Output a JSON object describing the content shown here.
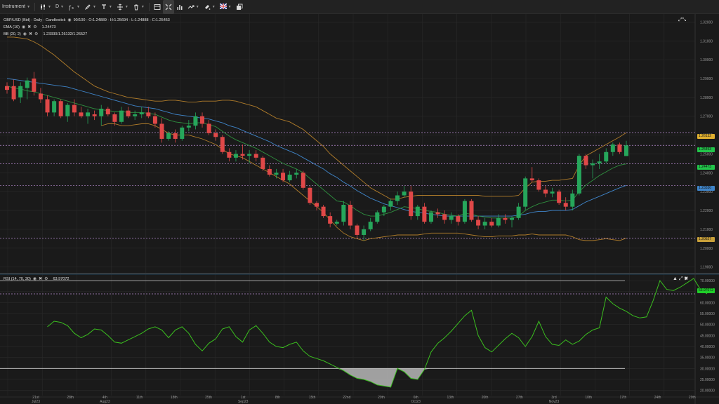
{
  "toolbar": {
    "instrument_label": "Instrument",
    "timeframe_label": "D",
    "flag_icon": "uk-flag-icon",
    "items": [
      {
        "name": "instrument-dropdown",
        "icon": "",
        "label": "Instrument"
      },
      {
        "name": "chart-type-dropdown",
        "icon": "candlestick-icon"
      },
      {
        "name": "timeframe-dropdown",
        "label": "D"
      },
      {
        "name": "indicators-dropdown",
        "icon": "indicator-icon"
      },
      {
        "name": "drawing-tools-dropdown",
        "icon": "pencil-icon"
      },
      {
        "name": "text-tools-dropdown",
        "icon": "text-icon"
      },
      {
        "name": "zoom-dropdown",
        "icon": "zoom-icon"
      },
      {
        "name": "delete-dropdown",
        "icon": "trash-icon"
      },
      {
        "name": "layout-button",
        "icon": "layout-icon"
      },
      {
        "name": "crosshair-button",
        "icon": "crosshair-icon"
      },
      {
        "name": "volume-button",
        "icon": "bars-icon"
      },
      {
        "name": "trade-dropdown",
        "icon": "arrow-icon"
      },
      {
        "name": "settings-dropdown",
        "icon": "paint-icon"
      },
      {
        "name": "language-dropdown",
        "icon": "uk-flag-icon"
      },
      {
        "name": "popout-button",
        "icon": "window-icon"
      }
    ]
  },
  "legend": {
    "main": "GBP/USD (Bid) - Daily - Candlestick",
    "ohlc": "90/100 - O:1.24889 - H:1.25694 - L:1.24888 - C:1.25453",
    "ema_name": "EMA (10)",
    "ema_value": "1.24473",
    "bb_name": "BB (20, 2)",
    "bb_value": "1.23330/1.26132/1.26527",
    "rsi_name": "RSI (14, 70, 30)",
    "rsi_value": "63.97072"
  },
  "colors": {
    "background": "#1a1a1a",
    "up": "#26a65b",
    "down": "#e04848",
    "ema": "#2f8f3f",
    "bb_outer": "#b07c2a",
    "bb_mid": "#3f84c8",
    "rsi_line": "#3bbf1f",
    "grid": "#2a2a2a",
    "hline": "#b68ad0"
  },
  "price_axis": {
    "ticks": [
      "1.32000",
      "1.31000",
      "1.30000",
      "1.29000",
      "1.28000",
      "1.27000",
      "1.26000",
      "1.25000",
      "1.24000",
      "1.23000",
      "1.22000",
      "1.21000",
      "1.20000",
      "1.19000"
    ],
    "markers": [
      {
        "label": "1.26132",
        "color": "#e0b030"
      },
      {
        "label": "1.25453",
        "color": "#22c44a"
      },
      {
        "label": "1.24473",
        "color": "#22c44a"
      },
      {
        "label": "1.23330",
        "color": "#3f84c8"
      },
      {
        "label": "1.20527",
        "color": "#c8a03a"
      }
    ]
  },
  "rsi_axis": {
    "ticks": [
      "70.00000",
      "65.00000",
      "60.00000",
      "55.00000",
      "50.00000",
      "45.00000",
      "40.00000",
      "35.00000",
      "30.00000",
      "25.00000",
      "20.00000"
    ],
    "marker": "63.97072"
  },
  "time_axis": {
    "labels": [
      {
        "day": "21st",
        "month": "Jul23"
      },
      {
        "day": "28th",
        "month": ""
      },
      {
        "day": "4th",
        "month": "Aug23"
      },
      {
        "day": "11th",
        "month": ""
      },
      {
        "day": "18th",
        "month": ""
      },
      {
        "day": "25th",
        "month": ""
      },
      {
        "day": "1st",
        "month": "Sep23"
      },
      {
        "day": "8th",
        "month": ""
      },
      {
        "day": "15th",
        "month": ""
      },
      {
        "day": "22nd",
        "month": ""
      },
      {
        "day": "29th",
        "month": ""
      },
      {
        "day": "6th",
        "month": "Oct23"
      },
      {
        "day": "13th",
        "month": ""
      },
      {
        "day": "20th",
        "month": ""
      },
      {
        "day": "27th",
        "month": ""
      },
      {
        "day": "3rd",
        "month": "Nov23"
      },
      {
        "day": "10th",
        "month": ""
      },
      {
        "day": "17th",
        "month": ""
      },
      {
        "day": "24th",
        "month": ""
      },
      {
        "day": "29th",
        "month": ""
      }
    ]
  },
  "chart_data": {
    "type": "candlestick",
    "title": "GBP/USD (Bid) - Daily - Candlestick",
    "ylim": [
      1.188,
      1.3235
    ],
    "horizontal_levels": [
      1.26132,
      1.25453,
      1.24473,
      1.2333,
      1.20527
    ],
    "candles": [
      {
        "o": 1.286,
        "h": 1.288,
        "l": 1.282,
        "c": 1.284
      },
      {
        "o": 1.286,
        "h": 1.2895,
        "l": 1.278,
        "c": 1.279
      },
      {
        "o": 1.28,
        "h": 1.288,
        "l": 1.277,
        "c": 1.286
      },
      {
        "o": 1.285,
        "h": 1.2905,
        "l": 1.279,
        "c": 1.289
      },
      {
        "o": 1.29,
        "h": 1.2935,
        "l": 1.281,
        "c": 1.283
      },
      {
        "o": 1.282,
        "h": 1.285,
        "l": 1.277,
        "c": 1.279
      },
      {
        "o": 1.279,
        "h": 1.281,
        "l": 1.27,
        "c": 1.272
      },
      {
        "o": 1.272,
        "h": 1.279,
        "l": 1.27,
        "c": 1.278
      },
      {
        "o": 1.278,
        "h": 1.279,
        "l": 1.269,
        "c": 1.27
      },
      {
        "o": 1.27,
        "h": 1.277,
        "l": 1.267,
        "c": 1.276
      },
      {
        "o": 1.276,
        "h": 1.279,
        "l": 1.27,
        "c": 1.272
      },
      {
        "o": 1.272,
        "h": 1.275,
        "l": 1.269,
        "c": 1.27
      },
      {
        "o": 1.27,
        "h": 1.274,
        "l": 1.266,
        "c": 1.272
      },
      {
        "o": 1.271,
        "h": 1.273,
        "l": 1.268,
        "c": 1.27
      },
      {
        "o": 1.27,
        "h": 1.276,
        "l": 1.265,
        "c": 1.274
      },
      {
        "o": 1.274,
        "h": 1.275,
        "l": 1.27,
        "c": 1.271
      },
      {
        "o": 1.271,
        "h": 1.272,
        "l": 1.265,
        "c": 1.267
      },
      {
        "o": 1.267,
        "h": 1.275,
        "l": 1.266,
        "c": 1.273
      },
      {
        "o": 1.273,
        "h": 1.275,
        "l": 1.269,
        "c": 1.27
      },
      {
        "o": 1.27,
        "h": 1.273,
        "l": 1.268,
        "c": 1.271
      },
      {
        "o": 1.271,
        "h": 1.275,
        "l": 1.269,
        "c": 1.272
      },
      {
        "o": 1.272,
        "h": 1.275,
        "l": 1.269,
        "c": 1.27
      },
      {
        "o": 1.27,
        "h": 1.272,
        "l": 1.264,
        "c": 1.266
      },
      {
        "o": 1.266,
        "h": 1.269,
        "l": 1.256,
        "c": 1.258
      },
      {
        "o": 1.258,
        "h": 1.262,
        "l": 1.257,
        "c": 1.261
      },
      {
        "o": 1.261,
        "h": 1.263,
        "l": 1.256,
        "c": 1.258
      },
      {
        "o": 1.258,
        "h": 1.265,
        "l": 1.257,
        "c": 1.264
      },
      {
        "o": 1.264,
        "h": 1.268,
        "l": 1.262,
        "c": 1.265
      },
      {
        "o": 1.265,
        "h": 1.272,
        "l": 1.263,
        "c": 1.27
      },
      {
        "o": 1.27,
        "h": 1.272,
        "l": 1.264,
        "c": 1.266
      },
      {
        "o": 1.266,
        "h": 1.268,
        "l": 1.26,
        "c": 1.261
      },
      {
        "o": 1.261,
        "h": 1.263,
        "l": 1.257,
        "c": 1.259
      },
      {
        "o": 1.259,
        "h": 1.26,
        "l": 1.25,
        "c": 1.251
      },
      {
        "o": 1.251,
        "h": 1.253,
        "l": 1.246,
        "c": 1.248
      },
      {
        "o": 1.248,
        "h": 1.252,
        "l": 1.246,
        "c": 1.25
      },
      {
        "o": 1.25,
        "h": 1.255,
        "l": 1.247,
        "c": 1.249
      },
      {
        "o": 1.249,
        "h": 1.252,
        "l": 1.245,
        "c": 1.25
      },
      {
        "o": 1.25,
        "h": 1.252,
        "l": 1.246,
        "c": 1.248
      },
      {
        "o": 1.248,
        "h": 1.249,
        "l": 1.241,
        "c": 1.242
      },
      {
        "o": 1.242,
        "h": 1.244,
        "l": 1.238,
        "c": 1.239
      },
      {
        "o": 1.239,
        "h": 1.242,
        "l": 1.237,
        "c": 1.24
      },
      {
        "o": 1.24,
        "h": 1.242,
        "l": 1.235,
        "c": 1.236
      },
      {
        "o": 1.236,
        "h": 1.241,
        "l": 1.235,
        "c": 1.239
      },
      {
        "o": 1.239,
        "h": 1.242,
        "l": 1.237,
        "c": 1.24
      },
      {
        "o": 1.24,
        "h": 1.241,
        "l": 1.231,
        "c": 1.232
      },
      {
        "o": 1.232,
        "h": 1.233,
        "l": 1.223,
        "c": 1.224
      },
      {
        "o": 1.224,
        "h": 1.225,
        "l": 1.22,
        "c": 1.222
      },
      {
        "o": 1.222,
        "h": 1.223,
        "l": 1.216,
        "c": 1.217
      },
      {
        "o": 1.217,
        "h": 1.219,
        "l": 1.211,
        "c": 1.213
      },
      {
        "o": 1.213,
        "h": 1.215,
        "l": 1.212,
        "c": 1.214
      },
      {
        "o": 1.214,
        "h": 1.225,
        "l": 1.212,
        "c": 1.223
      },
      {
        "o": 1.223,
        "h": 1.225,
        "l": 1.21,
        "c": 1.212
      },
      {
        "o": 1.212,
        "h": 1.213,
        "l": 1.205,
        "c": 1.207
      },
      {
        "o": 1.207,
        "h": 1.212,
        "l": 1.204,
        "c": 1.21
      },
      {
        "o": 1.21,
        "h": 1.216,
        "l": 1.209,
        "c": 1.214
      },
      {
        "o": 1.214,
        "h": 1.22,
        "l": 1.213,
        "c": 1.219
      },
      {
        "o": 1.219,
        "h": 1.223,
        "l": 1.217,
        "c": 1.222
      },
      {
        "o": 1.222,
        "h": 1.226,
        "l": 1.22,
        "c": 1.225
      },
      {
        "o": 1.225,
        "h": 1.23,
        "l": 1.223,
        "c": 1.228
      },
      {
        "o": 1.228,
        "h": 1.233,
        "l": 1.227,
        "c": 1.23
      },
      {
        "o": 1.23,
        "h": 1.233,
        "l": 1.215,
        "c": 1.217
      },
      {
        "o": 1.217,
        "h": 1.223,
        "l": 1.215,
        "c": 1.222
      },
      {
        "o": 1.222,
        "h": 1.224,
        "l": 1.213,
        "c": 1.214
      },
      {
        "o": 1.214,
        "h": 1.22,
        "l": 1.213,
        "c": 1.219
      },
      {
        "o": 1.219,
        "h": 1.221,
        "l": 1.216,
        "c": 1.218
      },
      {
        "o": 1.218,
        "h": 1.22,
        "l": 1.213,
        "c": 1.215
      },
      {
        "o": 1.215,
        "h": 1.219,
        "l": 1.213,
        "c": 1.217
      },
      {
        "o": 1.217,
        "h": 1.218,
        "l": 1.212,
        "c": 1.214
      },
      {
        "o": 1.214,
        "h": 1.226,
        "l": 1.213,
        "c": 1.225
      },
      {
        "o": 1.225,
        "h": 1.226,
        "l": 1.214,
        "c": 1.215
      },
      {
        "o": 1.215,
        "h": 1.217,
        "l": 1.21,
        "c": 1.212
      },
      {
        "o": 1.212,
        "h": 1.216,
        "l": 1.21,
        "c": 1.214
      },
      {
        "o": 1.214,
        "h": 1.216,
        "l": 1.211,
        "c": 1.212
      },
      {
        "o": 1.212,
        "h": 1.218,
        "l": 1.211,
        "c": 1.216
      },
      {
        "o": 1.216,
        "h": 1.218,
        "l": 1.213,
        "c": 1.215
      },
      {
        "o": 1.215,
        "h": 1.217,
        "l": 1.211,
        "c": 1.216
      },
      {
        "o": 1.216,
        "h": 1.224,
        "l": 1.215,
        "c": 1.222
      },
      {
        "o": 1.222,
        "h": 1.238,
        "l": 1.22,
        "c": 1.237
      },
      {
        "o": 1.237,
        "h": 1.243,
        "l": 1.235,
        "c": 1.236
      },
      {
        "o": 1.236,
        "h": 1.237,
        "l": 1.23,
        "c": 1.231
      },
      {
        "o": 1.231,
        "h": 1.233,
        "l": 1.227,
        "c": 1.229
      },
      {
        "o": 1.229,
        "h": 1.232,
        "l": 1.227,
        "c": 1.23
      },
      {
        "o": 1.23,
        "h": 1.231,
        "l": 1.223,
        "c": 1.224
      },
      {
        "o": 1.224,
        "h": 1.227,
        "l": 1.22,
        "c": 1.222
      },
      {
        "o": 1.222,
        "h": 1.231,
        "l": 1.22,
        "c": 1.229
      },
      {
        "o": 1.229,
        "h": 1.25,
        "l": 1.228,
        "c": 1.249
      },
      {
        "o": 1.249,
        "h": 1.25,
        "l": 1.242,
        "c": 1.244
      },
      {
        "o": 1.244,
        "h": 1.247,
        "l": 1.237,
        "c": 1.245
      },
      {
        "o": 1.245,
        "h": 1.25,
        "l": 1.242,
        "c": 1.246
      },
      {
        "o": 1.246,
        "h": 1.253,
        "l": 1.245,
        "c": 1.251
      },
      {
        "o": 1.251,
        "h": 1.256,
        "l": 1.249,
        "c": 1.255
      },
      {
        "o": 1.255,
        "h": 1.256,
        "l": 1.25,
        "c": 1.251
      },
      {
        "o": 1.24889,
        "h": 1.25694,
        "l": 1.24888,
        "c": 1.25453
      }
    ],
    "ema": [
      1.286,
      1.285,
      1.2845,
      1.2835,
      1.283,
      1.282,
      1.281,
      1.28,
      1.279,
      1.278,
      1.277,
      1.276,
      1.275,
      1.274,
      1.2735,
      1.273,
      1.2725,
      1.2725,
      1.272,
      1.272,
      1.272,
      1.2715,
      1.271,
      1.2695,
      1.268,
      1.267,
      1.2665,
      1.266,
      1.2665,
      1.2665,
      1.2655,
      1.2645,
      1.262,
      1.2595,
      1.2575,
      1.256,
      1.2545,
      1.253,
      1.251,
      1.249,
      1.247,
      1.245,
      1.2435,
      1.242,
      1.24,
      1.237,
      1.234,
      1.231,
      1.228,
      1.225,
      1.2245,
      1.2225,
      1.22,
      1.218,
      1.217,
      1.217,
      1.218,
      1.219,
      1.2205,
      1.222,
      1.2215,
      1.221,
      1.22,
      1.2195,
      1.219,
      1.218,
      1.2175,
      1.217,
      1.2185,
      1.218,
      1.217,
      1.2165,
      1.216,
      1.216,
      1.216,
      1.216,
      1.217,
      1.22,
      1.222,
      1.2235,
      1.2245,
      1.2255,
      1.2255,
      1.225,
      1.2255,
      1.23,
      1.2335,
      1.236,
      1.2385,
      1.2405,
      1.2425,
      1.244,
      1.2447
    ],
    "bb_mid": [
      1.29,
      1.2895,
      1.289,
      1.2885,
      1.288,
      1.2875,
      1.287,
      1.2865,
      1.286,
      1.2855,
      1.2845,
      1.2835,
      1.2825,
      1.2815,
      1.2805,
      1.2795,
      1.2785,
      1.2775,
      1.2765,
      1.2755,
      1.275,
      1.2745,
      1.274,
      1.273,
      1.272,
      1.271,
      1.2705,
      1.27,
      1.2695,
      1.269,
      1.2685,
      1.2675,
      1.2665,
      1.265,
      1.264,
      1.2625,
      1.261,
      1.2595,
      1.258,
      1.2565,
      1.2545,
      1.253,
      1.2515,
      1.25,
      1.248,
      1.246,
      1.244,
      1.242,
      1.2395,
      1.2375,
      1.235,
      1.233,
      1.2305,
      1.2285,
      1.2265,
      1.225,
      1.2235,
      1.2225,
      1.2215,
      1.2205,
      1.2195,
      1.219,
      1.2185,
      1.218,
      1.2175,
      1.217,
      1.217,
      1.217,
      1.217,
      1.217,
      1.217,
      1.217,
      1.217,
      1.217,
      1.217,
      1.217,
      1.2175,
      1.218,
      1.219,
      1.2195,
      1.2195,
      1.22,
      1.22,
      1.22,
      1.2205,
      1.2225,
      1.2245,
      1.226,
      1.2275,
      1.229,
      1.2305,
      1.232,
      1.2333
    ],
    "bb_upper": [
      1.312,
      1.312,
      1.3115,
      1.311,
      1.3095,
      1.3075,
      1.305,
      1.3025,
      1.2995,
      1.2965,
      1.2935,
      1.291,
      1.2885,
      1.286,
      1.2845,
      1.283,
      1.282,
      1.281,
      1.28,
      1.2795,
      1.279,
      1.2785,
      1.278,
      1.278,
      1.2785,
      1.2785,
      1.278,
      1.2775,
      1.2775,
      1.278,
      1.278,
      1.278,
      1.2785,
      1.2785,
      1.278,
      1.277,
      1.276,
      1.275,
      1.273,
      1.271,
      1.269,
      1.268,
      1.267,
      1.265,
      1.263,
      1.26,
      1.257,
      1.254,
      1.25,
      1.247,
      1.244,
      1.241,
      1.238,
      1.235,
      1.232,
      1.23,
      1.228,
      1.226,
      1.226,
      1.227,
      1.2275,
      1.228,
      1.228,
      1.228,
      1.228,
      1.228,
      1.228,
      1.228,
      1.228,
      1.228,
      1.228,
      1.2275,
      1.2275,
      1.2275,
      1.2275,
      1.2275,
      1.228,
      1.232,
      1.235,
      1.2355,
      1.2355,
      1.236,
      1.236,
      1.2365,
      1.237,
      1.244,
      1.249,
      1.251,
      1.253,
      1.255,
      1.257,
      1.259,
      1.2613
    ],
    "bb_lower": [
      null,
      null,
      null,
      null,
      null,
      null,
      null,
      null,
      null,
      null,
      null,
      null,
      null,
      null,
      1.265,
      1.266,
      1.266,
      1.265,
      1.265,
      1.2655,
      1.266,
      1.266,
      1.265,
      1.263,
      1.261,
      1.26,
      1.26,
      1.26,
      1.259,
      1.258,
      1.2565,
      1.255,
      1.2525,
      1.25,
      1.249,
      1.248,
      1.246,
      1.244,
      1.242,
      1.24,
      1.238,
      1.236,
      1.234,
      1.231,
      1.228,
      1.225,
      1.222,
      1.219,
      1.215,
      1.211,
      1.208,
      1.206,
      1.205,
      1.204,
      1.205,
      1.2055,
      1.206,
      1.2065,
      1.207,
      1.207,
      1.207,
      1.207,
      1.2075,
      1.208,
      1.208,
      1.208,
      1.208,
      1.208,
      1.2075,
      1.207,
      1.2065,
      1.206,
      1.206,
      1.2065,
      1.2065,
      1.2065,
      1.207,
      1.207,
      1.2075,
      1.207,
      1.207,
      1.207,
      1.207,
      1.207,
      1.206,
      1.2045,
      1.204,
      1.204,
      1.2045,
      1.205,
      1.2045,
      1.204,
      1.2053
    ],
    "rsi": [
      null,
      null,
      null,
      null,
      null,
      null,
      49.0,
      51.5,
      51.0,
      49.5,
      46.0,
      44.0,
      45.5,
      48.0,
      47.5,
      45.0,
      42.0,
      41.5,
      43.0,
      44.5,
      46.0,
      48.0,
      49.0,
      47.5,
      44.0,
      47.5,
      49.0,
      46.0,
      41.0,
      38.0,
      41.5,
      43.5,
      48.0,
      49.0,
      44.5,
      42.0,
      47.5,
      49.5,
      46.0,
      42.0,
      40.0,
      39.5,
      41.0,
      42.0,
      38.0,
      35.5,
      34.5,
      33.5,
      32.0,
      30.5,
      29.0,
      27.0,
      25.5,
      25.0,
      24.0,
      22.5,
      22.0,
      21.5,
      30.0,
      28.5,
      25.5,
      25.0,
      29.5,
      37.5,
      41.5,
      44.0,
      47.0,
      50.5,
      54.0,
      56.5,
      45.0,
      39.5,
      37.5,
      40.5,
      43.5,
      46.0,
      44.0,
      40.0,
      44.5,
      51.5,
      44.5,
      41.0,
      40.5,
      43.0,
      41.0,
      42.5,
      45.5,
      47.5,
      48.5,
      62.5,
      59.5,
      57.5,
      56.0,
      54.0,
      53.0,
      53.5,
      61.0,
      70.0,
      66.0,
      65.5,
      67.0,
      69.0,
      71.0,
      66.0,
      64.0
    ]
  }
}
